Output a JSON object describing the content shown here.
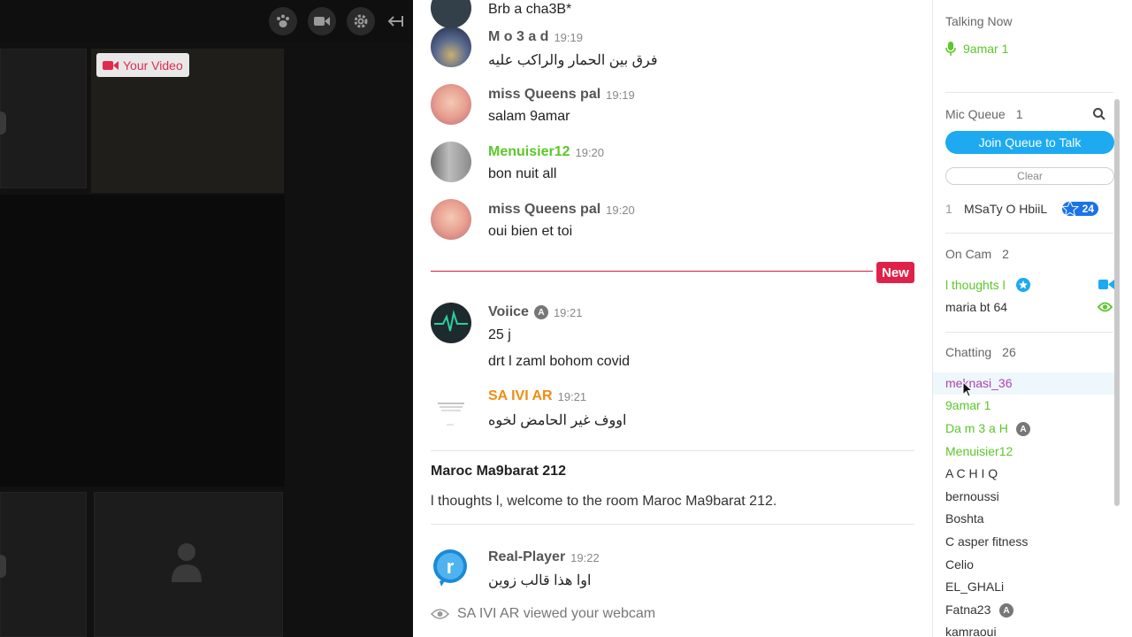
{
  "video": {
    "your_video_label": "Your Video"
  },
  "chat": {
    "messages": [
      {
        "text": "Brb a cha3B*"
      },
      {
        "name": "M o 3 a d",
        "time": "19:19",
        "text": "فرق بين الحمار والراكب عليه"
      },
      {
        "name": "miss Queens pal",
        "time": "19:19",
        "text": "salam 9amar"
      },
      {
        "name": "Menuisier12",
        "time": "19:20",
        "text": "bon nuit all"
      },
      {
        "name": "miss Queens pal",
        "time": "19:20",
        "text": "oui bien et toi"
      },
      {
        "name": "Voiice",
        "badge": "A",
        "time": "19:21",
        "text": "25 j",
        "text2": "drt l zaml bohom covid"
      },
      {
        "name": "SA IVI AR",
        "time": "19:21",
        "text": "اووف غير الحامض لخوه"
      },
      {
        "name": "Real-Player",
        "time": "19:22",
        "text": "اوا هذا قالب زوين"
      }
    ],
    "new_label": "New",
    "system_title": "Maroc Ma9barat 212",
    "system_text": "l thoughts l, welcome to the room  Maroc Ma9barat 212.",
    "viewed_text": "SA IVI AR viewed your webcam"
  },
  "sidebar": {
    "talking_now": "Talking Now",
    "talking_user": "9amar 1",
    "mic_queue": "Mic Queue",
    "mic_queue_count": "1",
    "join_queue": "Join Queue to Talk",
    "clear": "Clear",
    "queue": [
      {
        "index": "1",
        "name": "MSaTy O HbiiL",
        "star_count": "24"
      }
    ],
    "on_cam": "On Cam",
    "on_cam_count": "2",
    "on_cam_users": [
      "l thoughts l",
      "maria bt 64"
    ],
    "chatting": "Chatting",
    "chatting_count": "26",
    "chatting_users": [
      "meknasi_36",
      "9amar 1",
      "Da m 3 a H",
      "Menuisier12",
      "A C H I Q",
      "bernoussi",
      "Boshta",
      "C asper fitness",
      "Celio",
      "EL_GHALi",
      "Fatna23",
      "kamraoui"
    ]
  },
  "colors": {
    "accent_blue": "#1eaaf1",
    "new_red": "#e0224a",
    "green_user": "#5cc72a",
    "orange_user": "#ef8c12"
  }
}
